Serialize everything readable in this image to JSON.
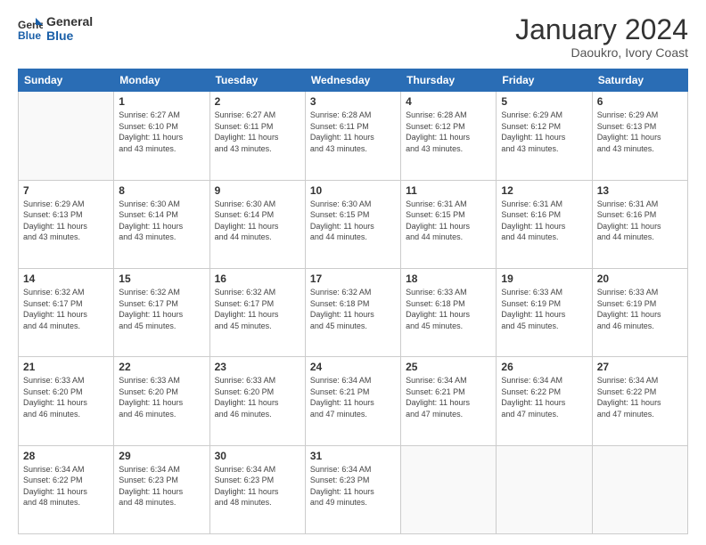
{
  "logo": {
    "line1": "General",
    "line2": "Blue"
  },
  "title": "January 2024",
  "subtitle": "Daoukro, Ivory Coast",
  "days_of_week": [
    "Sunday",
    "Monday",
    "Tuesday",
    "Wednesday",
    "Thursday",
    "Friday",
    "Saturday"
  ],
  "weeks": [
    [
      {
        "num": "",
        "detail": ""
      },
      {
        "num": "1",
        "detail": "Sunrise: 6:27 AM\nSunset: 6:10 PM\nDaylight: 11 hours\nand 43 minutes."
      },
      {
        "num": "2",
        "detail": "Sunrise: 6:27 AM\nSunset: 6:11 PM\nDaylight: 11 hours\nand 43 minutes."
      },
      {
        "num": "3",
        "detail": "Sunrise: 6:28 AM\nSunset: 6:11 PM\nDaylight: 11 hours\nand 43 minutes."
      },
      {
        "num": "4",
        "detail": "Sunrise: 6:28 AM\nSunset: 6:12 PM\nDaylight: 11 hours\nand 43 minutes."
      },
      {
        "num": "5",
        "detail": "Sunrise: 6:29 AM\nSunset: 6:12 PM\nDaylight: 11 hours\nand 43 minutes."
      },
      {
        "num": "6",
        "detail": "Sunrise: 6:29 AM\nSunset: 6:13 PM\nDaylight: 11 hours\nand 43 minutes."
      }
    ],
    [
      {
        "num": "7",
        "detail": "Sunrise: 6:29 AM\nSunset: 6:13 PM\nDaylight: 11 hours\nand 43 minutes."
      },
      {
        "num": "8",
        "detail": "Sunrise: 6:30 AM\nSunset: 6:14 PM\nDaylight: 11 hours\nand 43 minutes."
      },
      {
        "num": "9",
        "detail": "Sunrise: 6:30 AM\nSunset: 6:14 PM\nDaylight: 11 hours\nand 44 minutes."
      },
      {
        "num": "10",
        "detail": "Sunrise: 6:30 AM\nSunset: 6:15 PM\nDaylight: 11 hours\nand 44 minutes."
      },
      {
        "num": "11",
        "detail": "Sunrise: 6:31 AM\nSunset: 6:15 PM\nDaylight: 11 hours\nand 44 minutes."
      },
      {
        "num": "12",
        "detail": "Sunrise: 6:31 AM\nSunset: 6:16 PM\nDaylight: 11 hours\nand 44 minutes."
      },
      {
        "num": "13",
        "detail": "Sunrise: 6:31 AM\nSunset: 6:16 PM\nDaylight: 11 hours\nand 44 minutes."
      }
    ],
    [
      {
        "num": "14",
        "detail": "Sunrise: 6:32 AM\nSunset: 6:17 PM\nDaylight: 11 hours\nand 44 minutes."
      },
      {
        "num": "15",
        "detail": "Sunrise: 6:32 AM\nSunset: 6:17 PM\nDaylight: 11 hours\nand 45 minutes."
      },
      {
        "num": "16",
        "detail": "Sunrise: 6:32 AM\nSunset: 6:17 PM\nDaylight: 11 hours\nand 45 minutes."
      },
      {
        "num": "17",
        "detail": "Sunrise: 6:32 AM\nSunset: 6:18 PM\nDaylight: 11 hours\nand 45 minutes."
      },
      {
        "num": "18",
        "detail": "Sunrise: 6:33 AM\nSunset: 6:18 PM\nDaylight: 11 hours\nand 45 minutes."
      },
      {
        "num": "19",
        "detail": "Sunrise: 6:33 AM\nSunset: 6:19 PM\nDaylight: 11 hours\nand 45 minutes."
      },
      {
        "num": "20",
        "detail": "Sunrise: 6:33 AM\nSunset: 6:19 PM\nDaylight: 11 hours\nand 46 minutes."
      }
    ],
    [
      {
        "num": "21",
        "detail": "Sunrise: 6:33 AM\nSunset: 6:20 PM\nDaylight: 11 hours\nand 46 minutes."
      },
      {
        "num": "22",
        "detail": "Sunrise: 6:33 AM\nSunset: 6:20 PM\nDaylight: 11 hours\nand 46 minutes."
      },
      {
        "num": "23",
        "detail": "Sunrise: 6:33 AM\nSunset: 6:20 PM\nDaylight: 11 hours\nand 46 minutes."
      },
      {
        "num": "24",
        "detail": "Sunrise: 6:34 AM\nSunset: 6:21 PM\nDaylight: 11 hours\nand 47 minutes."
      },
      {
        "num": "25",
        "detail": "Sunrise: 6:34 AM\nSunset: 6:21 PM\nDaylight: 11 hours\nand 47 minutes."
      },
      {
        "num": "26",
        "detail": "Sunrise: 6:34 AM\nSunset: 6:22 PM\nDaylight: 11 hours\nand 47 minutes."
      },
      {
        "num": "27",
        "detail": "Sunrise: 6:34 AM\nSunset: 6:22 PM\nDaylight: 11 hours\nand 47 minutes."
      }
    ],
    [
      {
        "num": "28",
        "detail": "Sunrise: 6:34 AM\nSunset: 6:22 PM\nDaylight: 11 hours\nand 48 minutes."
      },
      {
        "num": "29",
        "detail": "Sunrise: 6:34 AM\nSunset: 6:23 PM\nDaylight: 11 hours\nand 48 minutes."
      },
      {
        "num": "30",
        "detail": "Sunrise: 6:34 AM\nSunset: 6:23 PM\nDaylight: 11 hours\nand 48 minutes."
      },
      {
        "num": "31",
        "detail": "Sunrise: 6:34 AM\nSunset: 6:23 PM\nDaylight: 11 hours\nand 49 minutes."
      },
      {
        "num": "",
        "detail": ""
      },
      {
        "num": "",
        "detail": ""
      },
      {
        "num": "",
        "detail": ""
      }
    ]
  ]
}
